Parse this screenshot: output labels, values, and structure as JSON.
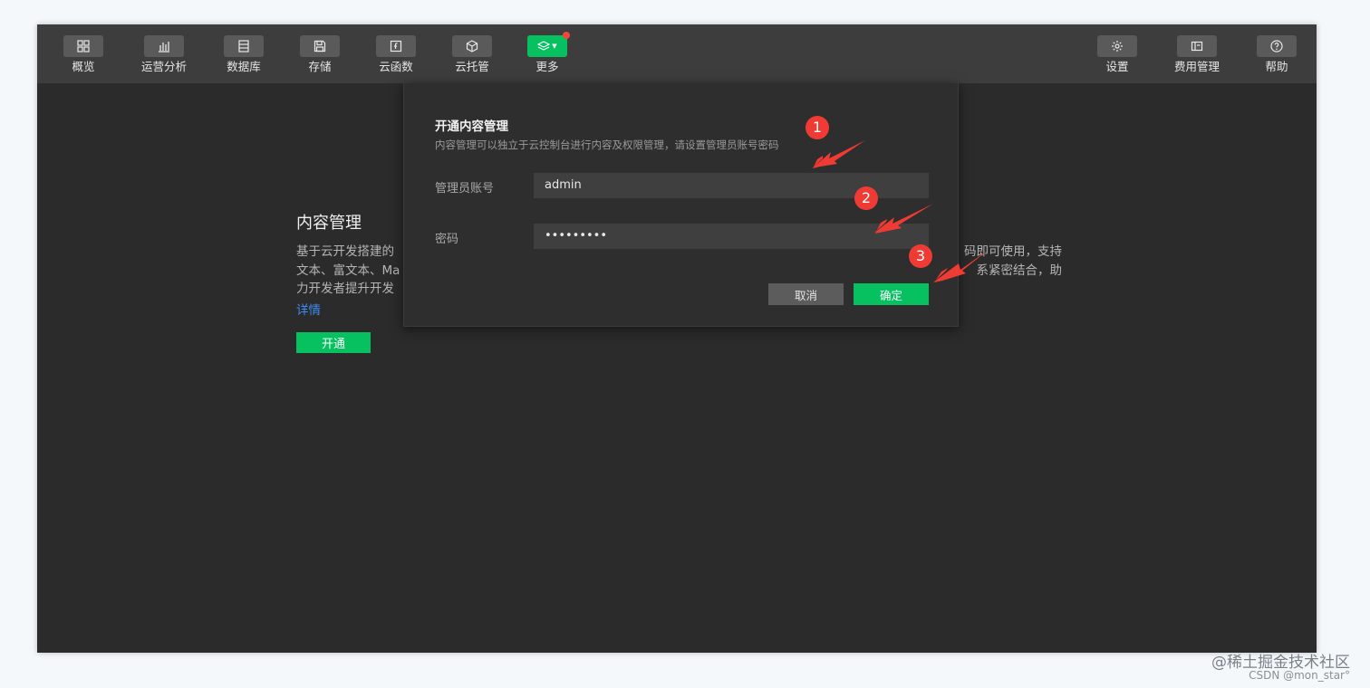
{
  "toolbar": {
    "items": [
      {
        "label": "概览",
        "icon": "grid-icon"
      },
      {
        "label": "运营分析",
        "icon": "bar-chart-icon"
      },
      {
        "label": "数据库",
        "icon": "database-icon"
      },
      {
        "label": "存储",
        "icon": "save-icon"
      },
      {
        "label": "云函数",
        "icon": "function-icon"
      },
      {
        "label": "云托管",
        "icon": "cube-icon"
      },
      {
        "label": "更多",
        "icon": "layers-icon"
      }
    ],
    "right_items": [
      {
        "label": "设置",
        "icon": "gear-icon"
      },
      {
        "label": "费用管理",
        "icon": "billing-icon"
      },
      {
        "label": "帮助",
        "icon": "help-icon"
      }
    ]
  },
  "content": {
    "title": "内容管理",
    "desc_line1_left": "基于云开发搭建的",
    "desc_line1_right": "码即可使用，支持",
    "desc_line2_left": "文本、富文本、Ma",
    "desc_line2_right": "系紧密结合，助",
    "desc_line3_left": "力开发者提升开发",
    "detail_link": "详情",
    "open_button": "开通"
  },
  "modal": {
    "title": "开通内容管理",
    "description": "内容管理可以独立于云控制台进行内容及权限管理，请设置管理员账号密码",
    "account_label": "管理员账号",
    "account_value": "admin",
    "password_label": "密码",
    "password_value": "•••••••••",
    "cancel_button": "取消",
    "confirm_button": "确定"
  },
  "annotations": [
    "1",
    "2",
    "3"
  ],
  "watermark": {
    "line1": "@稀土掘金技术社区",
    "line2": "CSDN @mon_star°"
  },
  "colors": {
    "accent": "#07c160",
    "background": "#2b2b2b",
    "toolbar": "#3d3d3d",
    "annotation_red": "#f03b35",
    "link": "#3c8cf3"
  }
}
